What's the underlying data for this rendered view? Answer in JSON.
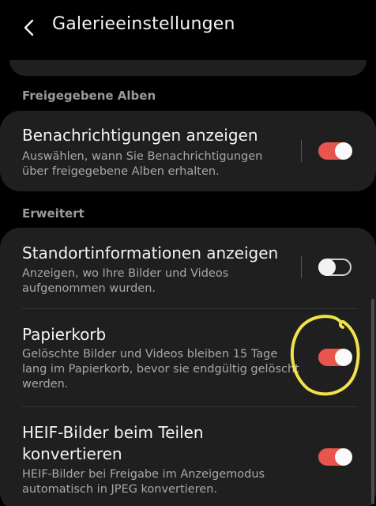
{
  "header": {
    "title": "Galerieeinstellungen"
  },
  "sections": {
    "shared": {
      "label": "Freigegebene Alben",
      "notifications": {
        "title": "Benachrichtigungen anzeigen",
        "desc1": "Auswählen, wann Sie Benachrichtigungen",
        "desc2": "über freigegebene Alben erhalten.",
        "enabled": true
      }
    },
    "advanced": {
      "label": "Erweitert",
      "location": {
        "title": "Standortinformationen anzeigen",
        "desc1": "Anzeigen, wo Ihre Bilder und Videos",
        "desc2": "aufgenommen wurden.",
        "enabled": false
      },
      "trash": {
        "title": "Papierkorb",
        "desc1": "Gelöschte Bilder und Videos bleiben 15 Tage",
        "desc2": "lang im Papierkorb, bevor sie endgültig gelöscht",
        "desc3": "werden.",
        "enabled": true
      },
      "heif": {
        "title1": "HEIF-Bilder beim Teilen",
        "title2": "konvertieren",
        "desc1": "HEIF-Bilder bei Freigabe im Anzeigemodus",
        "desc2": "automatisch in JPEG konvertieren.",
        "enabled": true
      }
    }
  },
  "colors": {
    "accent": "#e8554e",
    "annotation": "#f2e24a"
  },
  "icons": {
    "back": "chevron-left-icon"
  }
}
